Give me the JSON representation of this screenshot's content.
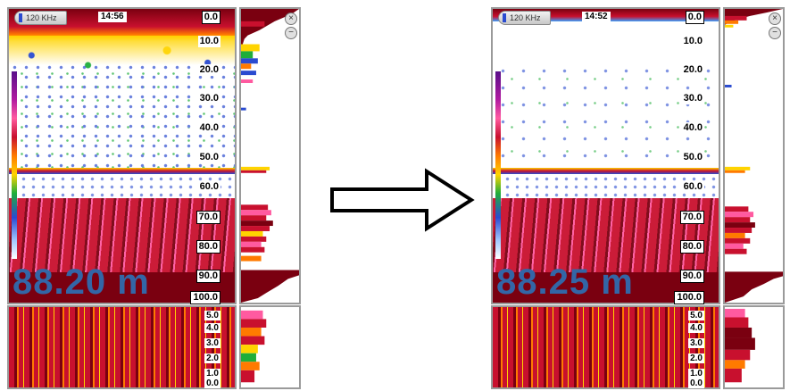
{
  "screens": [
    {
      "frequency": "120 KHz",
      "time": "14:56",
      "depth_reading": "88.20 m",
      "depth_scale": [
        "0.0",
        "10.0",
        "20.0",
        "30.0",
        "40.0",
        "50.0",
        "60.0",
        "70.0",
        "80.0",
        "90.0",
        "100.0"
      ],
      "bottom_scale": [
        "5.0",
        "4.0",
        "3.0",
        "2.0",
        "1.0",
        "0.0"
      ]
    },
    {
      "frequency": "120 KHz",
      "time": "14:52",
      "depth_reading": "88.25 m",
      "depth_scale": [
        "0.0",
        "10.0",
        "20.0",
        "30.0",
        "40.0",
        "50.0",
        "60.0",
        "70.0",
        "80.0",
        "90.0",
        "100.0"
      ],
      "bottom_scale": [
        "5.0",
        "4.0",
        "3.0",
        "2.0",
        "1.0",
        "0.0"
      ]
    }
  ],
  "icons": {
    "close": "close-icon",
    "zoom_out": "minus-icon",
    "transition": "right-arrow-icon"
  },
  "colors": {
    "depth_text": "#3366a6",
    "echo_strong": "#7a0010",
    "echo_medium": "#c8102e"
  }
}
